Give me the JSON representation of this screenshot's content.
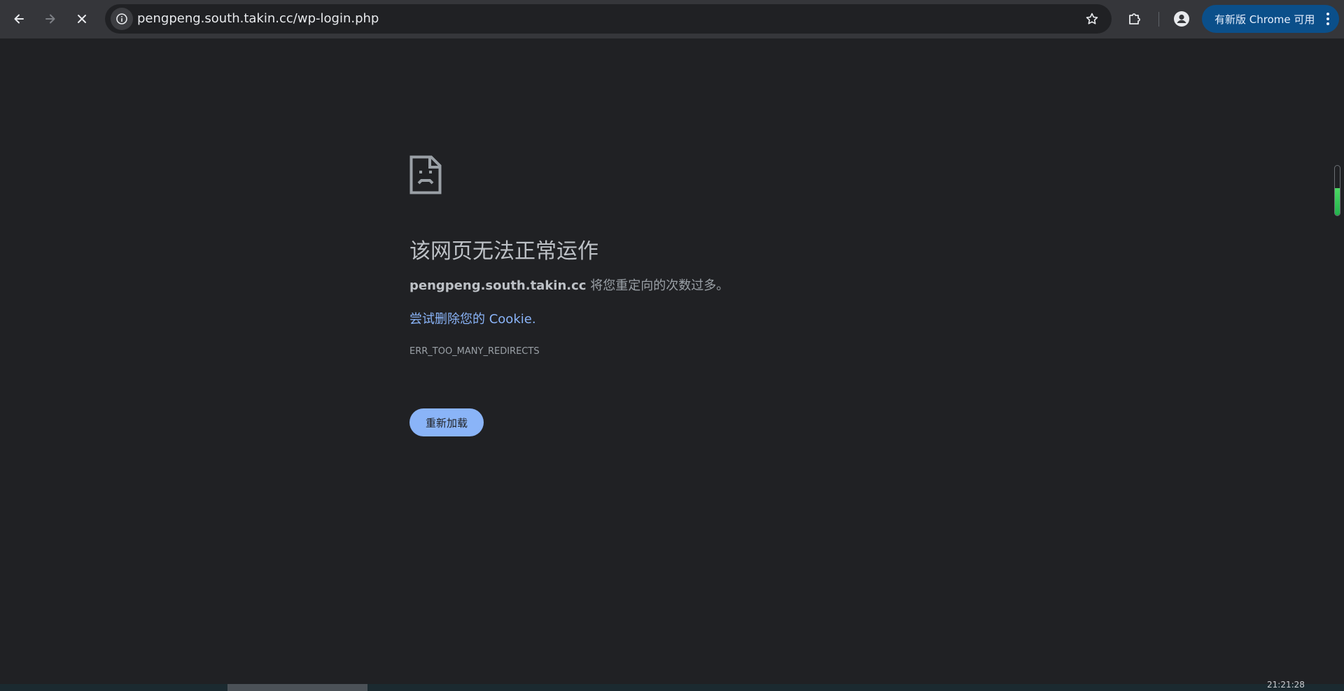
{
  "browser": {
    "url": "pengpeng.south.takin.cc/wp-login.php",
    "update_button_label": "有新版 Chrome 可用",
    "icons": {
      "back": "back-arrow-icon",
      "forward": "forward-arrow-icon",
      "stop": "stop-loading-icon",
      "site_info": "site-info-icon",
      "bookmark": "bookmark-star-icon",
      "extensions": "extensions-puzzle-icon",
      "profile": "profile-avatar-icon",
      "menu": "kebab-menu-icon"
    }
  },
  "error_page": {
    "icon": "sad-document-icon",
    "heading": "该网页无法正常运作",
    "host": "pengpeng.south.takin.cc",
    "message": " 将您重定向的次数过多。",
    "suggestion_link": "尝试删除您的 Cookie.",
    "error_code": "ERR_TOO_MANY_REDIRECTS",
    "reload_button_label": "重新加载"
  },
  "scroll_indicator": {
    "fill_fraction": 0.55,
    "colors": {
      "fill": "#22b14c",
      "border": "#6a6e73"
    }
  },
  "taskbar": {
    "clock": "21:21:28"
  },
  "colors": {
    "page_background": "#202124",
    "toolbar_background": "#35363a",
    "link": "#8ab4f8",
    "update_button": "#0b4f8a"
  }
}
